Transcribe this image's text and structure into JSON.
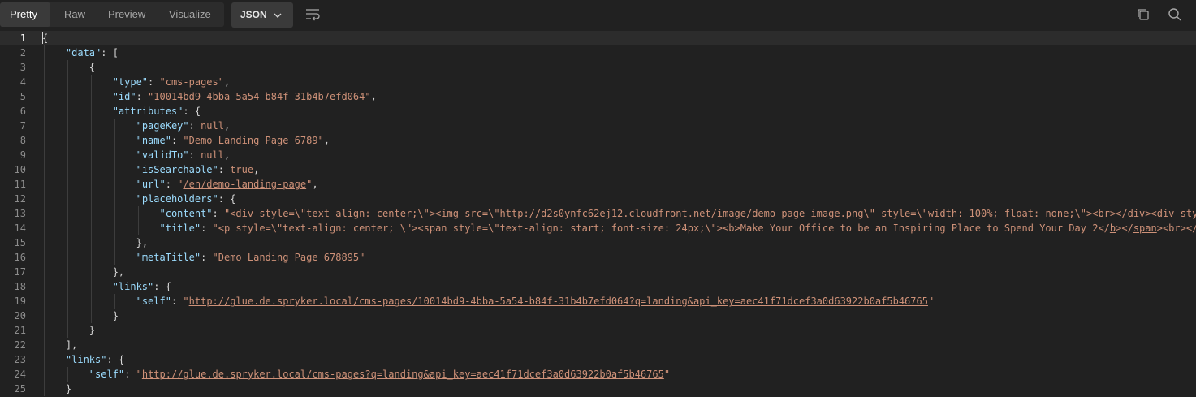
{
  "toolbar": {
    "tabs": [
      "Pretty",
      "Raw",
      "Preview",
      "Visualize"
    ],
    "active_tab": "Pretty",
    "format": "JSON"
  },
  "colors": {
    "background": "#212121",
    "key": "#9cdcfe",
    "string": "#ce9178",
    "punctuation": "#d6d6d6",
    "line_number": "#8c8c8c"
  },
  "lines": [
    {
      "n": "1",
      "indent": 0,
      "parts": [
        {
          "t": "p",
          "v": "{"
        }
      ]
    },
    {
      "n": "2",
      "indent": 1,
      "parts": [
        {
          "t": "k",
          "v": "\"data\""
        },
        {
          "t": "p",
          "v": ": ["
        }
      ]
    },
    {
      "n": "3",
      "indent": 2,
      "parts": [
        {
          "t": "p",
          "v": "{"
        }
      ]
    },
    {
      "n": "4",
      "indent": 3,
      "parts": [
        {
          "t": "k",
          "v": "\"type\""
        },
        {
          "t": "p",
          "v": ": "
        },
        {
          "t": "s",
          "v": "\"cms-pages\""
        },
        {
          "t": "p",
          "v": ","
        }
      ]
    },
    {
      "n": "5",
      "indent": 3,
      "parts": [
        {
          "t": "k",
          "v": "\"id\""
        },
        {
          "t": "p",
          "v": ": "
        },
        {
          "t": "s",
          "v": "\"10014bd9-4bba-5a54-b84f-31b4b7efd064\""
        },
        {
          "t": "p",
          "v": ","
        }
      ]
    },
    {
      "n": "6",
      "indent": 3,
      "parts": [
        {
          "t": "k",
          "v": "\"attributes\""
        },
        {
          "t": "p",
          "v": ": {"
        }
      ]
    },
    {
      "n": "7",
      "indent": 4,
      "parts": [
        {
          "t": "k",
          "v": "\"pageKey\""
        },
        {
          "t": "p",
          "v": ": "
        },
        {
          "t": "n",
          "v": "null"
        },
        {
          "t": "p",
          "v": ","
        }
      ]
    },
    {
      "n": "8",
      "indent": 4,
      "parts": [
        {
          "t": "k",
          "v": "\"name\""
        },
        {
          "t": "p",
          "v": ": "
        },
        {
          "t": "s",
          "v": "\"Demo Landing Page 6789\""
        },
        {
          "t": "p",
          "v": ","
        }
      ]
    },
    {
      "n": "9",
      "indent": 4,
      "parts": [
        {
          "t": "k",
          "v": "\"validTo\""
        },
        {
          "t": "p",
          "v": ": "
        },
        {
          "t": "n",
          "v": "null"
        },
        {
          "t": "p",
          "v": ","
        }
      ]
    },
    {
      "n": "10",
      "indent": 4,
      "parts": [
        {
          "t": "k",
          "v": "\"isSearchable\""
        },
        {
          "t": "p",
          "v": ": "
        },
        {
          "t": "n",
          "v": "true"
        },
        {
          "t": "p",
          "v": ","
        }
      ]
    },
    {
      "n": "11",
      "indent": 4,
      "parts": [
        {
          "t": "k",
          "v": "\"url\""
        },
        {
          "t": "p",
          "v": ": "
        },
        {
          "t": "s",
          "v": "\""
        },
        {
          "t": "su",
          "v": "/en/demo-landing-page"
        },
        {
          "t": "s",
          "v": "\""
        },
        {
          "t": "p",
          "v": ","
        }
      ]
    },
    {
      "n": "12",
      "indent": 4,
      "parts": [
        {
          "t": "k",
          "v": "\"placeholders\""
        },
        {
          "t": "p",
          "v": ": {"
        }
      ]
    },
    {
      "n": "13",
      "indent": 5,
      "parts": [
        {
          "t": "k",
          "v": "\"content\""
        },
        {
          "t": "p",
          "v": ": "
        },
        {
          "t": "s",
          "v": "\"<div style=\\\"text-align: center;\\\"><img src=\\\""
        },
        {
          "t": "su",
          "v": "http://d2s0ynfc62ej12.cloudfront.net/image/demo-page-image.png"
        },
        {
          "t": "s",
          "v": "\\\" style=\\\"width: 100%; float: none;\\\"><br></"
        },
        {
          "t": "su",
          "v": "div"
        },
        {
          "t": "s",
          "v": "><div style=\\\"text-align: center;\\\">"
        }
      ]
    },
    {
      "n": "14",
      "indent": 5,
      "parts": [
        {
          "t": "k",
          "v": "\"title\""
        },
        {
          "t": "p",
          "v": ": "
        },
        {
          "t": "s",
          "v": "\"<p style=\\\"text-align: center; \\\"><span style=\\\"text-align: start; font-size: 24px;\\\"><b>Make Your Office to be an Inspiring Place to Spend Your Day 2</"
        },
        {
          "t": "su",
          "v": "b"
        },
        {
          "t": "s",
          "v": "></"
        },
        {
          "t": "su",
          "v": "span"
        },
        {
          "t": "s",
          "v": "><br></"
        },
        {
          "t": "su",
          "v": "p"
        },
        {
          "t": "s",
          "v": ">\""
        }
      ]
    },
    {
      "n": "15",
      "indent": 4,
      "parts": [
        {
          "t": "p",
          "v": "},"
        }
      ]
    },
    {
      "n": "16",
      "indent": 4,
      "parts": [
        {
          "t": "k",
          "v": "\"metaTitle\""
        },
        {
          "t": "p",
          "v": ": "
        },
        {
          "t": "s",
          "v": "\"Demo Landing Page 678895\""
        }
      ]
    },
    {
      "n": "17",
      "indent": 3,
      "parts": [
        {
          "t": "p",
          "v": "},"
        }
      ]
    },
    {
      "n": "18",
      "indent": 3,
      "parts": [
        {
          "t": "k",
          "v": "\"links\""
        },
        {
          "t": "p",
          "v": ": {"
        }
      ]
    },
    {
      "n": "19",
      "indent": 4,
      "parts": [
        {
          "t": "k",
          "v": "\"self\""
        },
        {
          "t": "p",
          "v": ": "
        },
        {
          "t": "s",
          "v": "\""
        },
        {
          "t": "su",
          "v": "http://glue.de.spryker.local/cms-pages/10014bd9-4bba-5a54-b84f-31b4b7efd064?q=landing&api_key=aec41f71dcef3a0d63922b0af5b46765"
        },
        {
          "t": "s",
          "v": "\""
        }
      ]
    },
    {
      "n": "20",
      "indent": 3,
      "parts": [
        {
          "t": "p",
          "v": "}"
        }
      ]
    },
    {
      "n": "21",
      "indent": 2,
      "parts": [
        {
          "t": "p",
          "v": "}"
        }
      ]
    },
    {
      "n": "22",
      "indent": 1,
      "parts": [
        {
          "t": "p",
          "v": "],"
        }
      ]
    },
    {
      "n": "23",
      "indent": 1,
      "parts": [
        {
          "t": "k",
          "v": "\"links\""
        },
        {
          "t": "p",
          "v": ": {"
        }
      ]
    },
    {
      "n": "24",
      "indent": 2,
      "parts": [
        {
          "t": "k",
          "v": "\"self\""
        },
        {
          "t": "p",
          "v": ": "
        },
        {
          "t": "s",
          "v": "\""
        },
        {
          "t": "su",
          "v": "http://glue.de.spryker.local/cms-pages?q=landing&api_key=aec41f71dcef3a0d63922b0af5b46765"
        },
        {
          "t": "s",
          "v": "\""
        }
      ]
    },
    {
      "n": "25",
      "indent": 1,
      "parts": [
        {
          "t": "p",
          "v": "}"
        }
      ]
    }
  ]
}
